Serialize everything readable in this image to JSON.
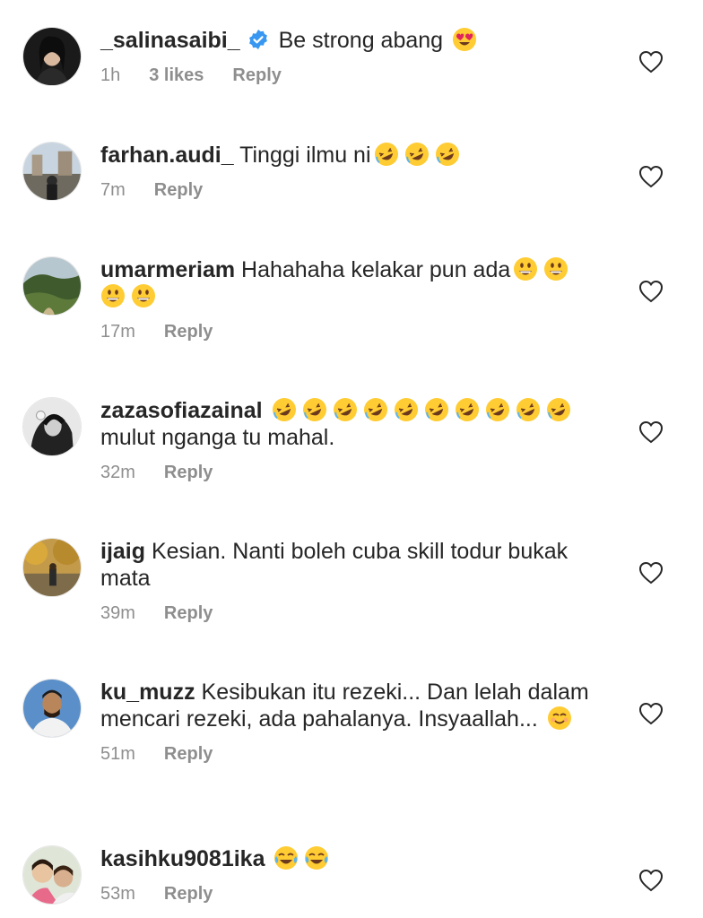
{
  "comments": [
    {
      "username": "_salinasaibi_",
      "verified": true,
      "text_before": "Be strong abang",
      "emojis": [
        "heart-eyes"
      ],
      "text_after": "",
      "time": "1h",
      "likes": "3 likes",
      "reply": "Reply"
    },
    {
      "username": "farhan.audi_",
      "text_before": "Tinggi ilmu ni",
      "emojis": [
        "rofl",
        "rofl",
        "rofl"
      ],
      "text_after": "",
      "time": "7m",
      "reply": "Reply"
    },
    {
      "username": "umarmeriam",
      "text_before": "Hahahaha kelakar pun ada",
      "emojis": [
        "grin",
        "grin",
        "grin",
        "grin"
      ],
      "text_after": "",
      "time": "17m",
      "reply": "Reply"
    },
    {
      "username": "zazasofiazainal",
      "text_before": "",
      "emojis": [
        "rofl",
        "rofl",
        "rofl",
        "rofl",
        "rofl",
        "rofl",
        "rofl",
        "rofl",
        "rofl",
        "rofl"
      ],
      "text_after": "mulut nganga tu mahal.",
      "time": "32m",
      "reply": "Reply"
    },
    {
      "username": "ijaig",
      "text_before": "Kesian. Nanti boleh cuba skill todur bukak mata",
      "emojis": [],
      "text_after": "",
      "time": "39m",
      "reply": "Reply"
    },
    {
      "username": "ku_muzz",
      "text_before": "Kesibukan itu rezeki... Dan lelah dalam mencari rezeki, ada pahalanya. Insyaallah...",
      "emojis": [
        "smile"
      ],
      "text_after": "",
      "time": "51m",
      "reply": "Reply"
    },
    {
      "username": "kasihku9081ika",
      "text_before": "",
      "emojis": [
        "joy",
        "joy"
      ],
      "text_after": "",
      "time": "53m",
      "reply": "Reply"
    }
  ],
  "colors": {
    "text": "#262626",
    "secondary": "#8e8e8e",
    "verified": "#3897f0"
  }
}
